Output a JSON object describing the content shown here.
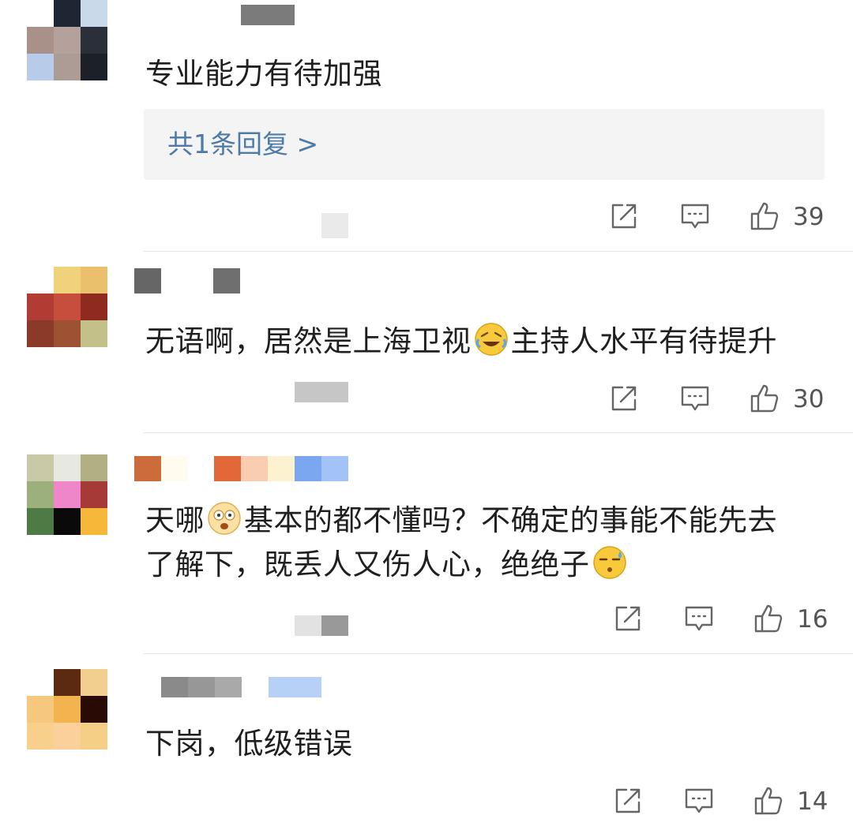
{
  "comments": [
    {
      "text": "专业能力有待加强",
      "reply_link": "共1条回复 >",
      "like_count": "39"
    },
    {
      "text_before": "无语啊，居然是上海卫视",
      "emoji_1": "laughing-crying-emoji",
      "text_after": "主持人水平有待提升",
      "like_count": "30"
    },
    {
      "text_line1_a": "天哪",
      "emoji_1": "shocked-emoji",
      "text_line1_b": "基本的都不懂吗？不确定的事能不能先去",
      "text_line2": "了解下，既丢人又伤人心，绝绝子",
      "emoji_2": "sweat-emoji",
      "like_count": "16"
    },
    {
      "text": "下岗，低级错误",
      "like_count": "14"
    }
  ],
  "icons": {
    "share": "share-icon",
    "comment": "comment-icon",
    "like": "thumbs-up-icon"
  },
  "colors": {
    "reply_link": "#4d7aa8",
    "divider": "#e6e6e6",
    "reply_bg": "#f4f4f4"
  }
}
